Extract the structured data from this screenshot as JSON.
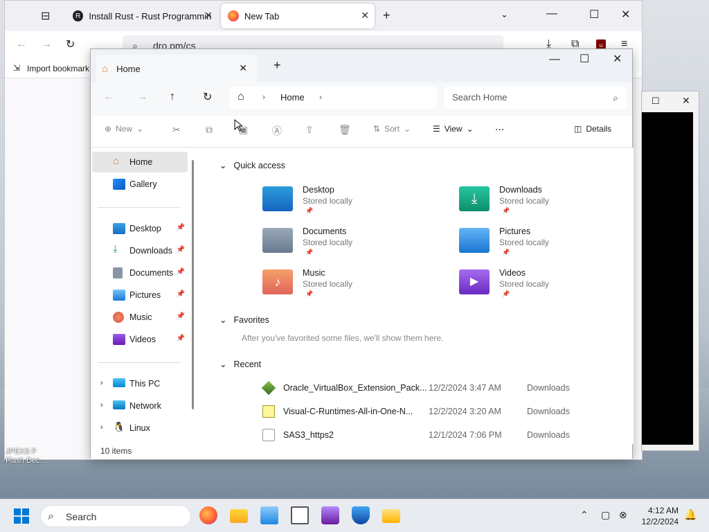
{
  "firefox": {
    "tabs": [
      {
        "label": "Install Rust - Rust Programming"
      },
      {
        "label": "New Tab"
      }
    ],
    "url": "dro.pm/cs",
    "bookmarks": {
      "import_label": "Import bookmark"
    }
  },
  "explorer": {
    "tab_title": "Home",
    "breadcrumb": "Home",
    "search_placeholder": "Search Home",
    "toolbar": {
      "new": "New",
      "sort": "Sort",
      "view": "View",
      "more": "...",
      "details": "Details"
    },
    "sidebar": {
      "top": [
        {
          "label": "Home"
        },
        {
          "label": "Gallery"
        }
      ],
      "pinned": [
        {
          "label": "Desktop"
        },
        {
          "label": "Downloads"
        },
        {
          "label": "Documents"
        },
        {
          "label": "Pictures"
        },
        {
          "label": "Music"
        },
        {
          "label": "Videos"
        }
      ],
      "drives": [
        {
          "label": "This PC"
        },
        {
          "label": "Network"
        },
        {
          "label": "Linux"
        }
      ]
    },
    "sections": {
      "quick_access": "Quick access",
      "favorites": "Favorites",
      "favorites_empty": "After you've favorited some files, we'll show them here.",
      "recent": "Recent"
    },
    "quick_access": [
      {
        "name": "Desktop",
        "sub": "Stored locally"
      },
      {
        "name": "Downloads",
        "sub": "Stored locally"
      },
      {
        "name": "Documents",
        "sub": "Stored locally"
      },
      {
        "name": "Pictures",
        "sub": "Stored locally"
      },
      {
        "name": "Music",
        "sub": "Stored locally"
      },
      {
        "name": "Videos",
        "sub": "Stored locally"
      }
    ],
    "recent": [
      {
        "name": "Oracle_VirtualBox_Extension_Pack...",
        "date": "12/2/2024 3:47 AM",
        "location": "Downloads"
      },
      {
        "name": "Visual-C-Runtimes-All-in-One-N...",
        "date": "12/2/2024 3:20 AM",
        "location": "Downloads"
      },
      {
        "name": "SAS3_https2",
        "date": "12/1/2024 7:06 PM",
        "location": "Downloads"
      }
    ],
    "status": "10 items"
  },
  "desktop": {
    "icon_label_1": "JPEXS F",
    "icon_label_2": "Flash Dec..."
  },
  "taskbar": {
    "search": "Search",
    "time": "4:12 AM",
    "date": "12/2/2024"
  }
}
